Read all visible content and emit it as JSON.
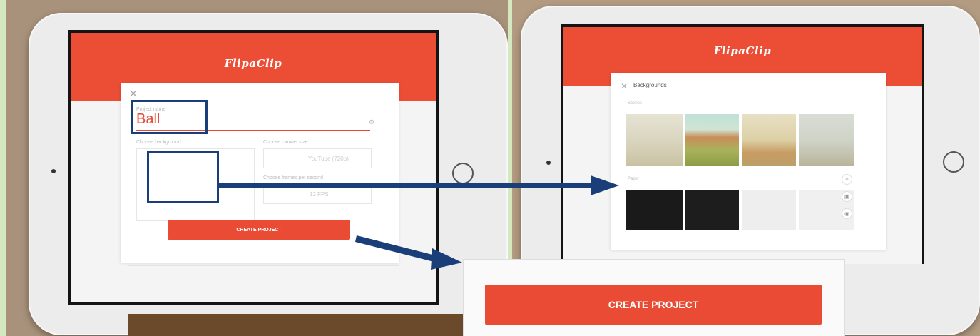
{
  "left": {
    "logo": "FlipaClip",
    "dialog": {
      "close_icon": "✕",
      "project_name_label": "Project name",
      "project_name_value": "Ball",
      "choose_background_label": "Choose background",
      "choose_canvas_size_label": "Choose canvas size",
      "canvas_size_value": "YouTube (720p)",
      "choose_fps_label": "Choose frames per second",
      "fps_value": "12 FPS",
      "create_button": "CREATE PROJECT"
    }
  },
  "right": {
    "logo": "FlipaClip",
    "dialog": {
      "close_icon": "✕",
      "title": "Backgrounds",
      "scenes_label": "Scenes",
      "paper_label": "Paper"
    }
  },
  "zoom": {
    "create_button": "CREATE PROJECT"
  },
  "colors": {
    "accent": "#ec4d35",
    "highlight": "#1a3e78"
  }
}
